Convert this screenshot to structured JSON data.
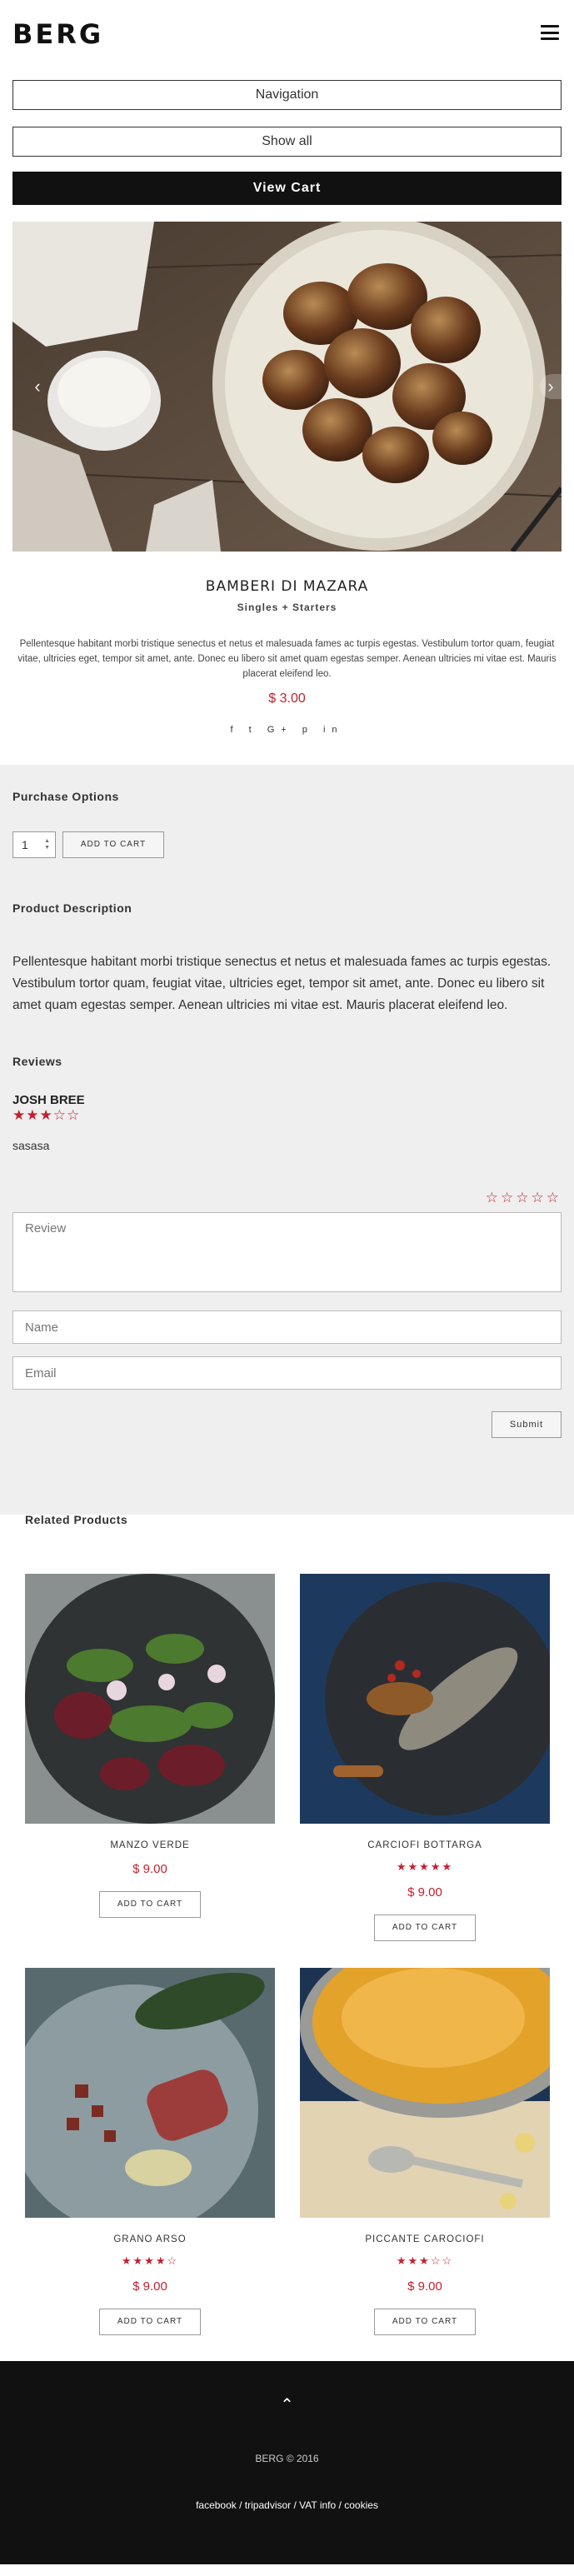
{
  "header": {
    "logo": "BERG",
    "menu_icon": "hamburger-icon"
  },
  "nav": {
    "navigation_label": "Navigation",
    "show_all_label": "Show all",
    "view_cart_label": "View Cart"
  },
  "slider": {
    "prev_icon": "chevron-left-icon",
    "next_icon": "chevron-right-icon",
    "prev_glyph": "‹",
    "next_glyph": "›"
  },
  "product": {
    "title": "BAMBERI DI MAZARA",
    "category": "Singles + Starters",
    "description": "Pellentesque habitant morbi tristique senectus et netus et malesuada fames ac turpis egestas. Vestibulum tortor quam, feugiat vitae, ultricies eget, tempor sit amet, ante. Donec eu libero sit amet quam egestas semper. Aenean ultricies mi vitae est. Mauris placerat eleifend leo.",
    "price": "$ 3.00",
    "social": [
      "f",
      "t",
      "G+",
      "p",
      "in"
    ]
  },
  "purchase": {
    "heading": "Purchase Options",
    "quantity": "1",
    "add_to_cart": "ADD TO CART"
  },
  "description_section": {
    "heading": "Product Description",
    "text": "Pellentesque habitant morbi tristique senectus et netus et malesuada fames ac turpis egestas. Vestibulum tortor quam, feugiat vitae, ultricies eget, tempor sit amet, ante. Donec eu libero sit amet quam egestas semper. Aenean ultricies mi vitae est. Mauris placerat eleifend leo."
  },
  "reviews": {
    "heading": "Reviews",
    "items": [
      {
        "author": "JOSH BREE",
        "rating": 3,
        "max": 5,
        "text": "sasasa"
      }
    ],
    "form": {
      "review_placeholder": "Review",
      "name_placeholder": "Name",
      "email_placeholder": "Email",
      "submit_label": "Submit",
      "rating": 0
    }
  },
  "related": {
    "heading": "Related Products",
    "items": [
      {
        "name": "MANZO VERDE",
        "price": "$ 9.00",
        "rating": null,
        "button": "ADD TO CART"
      },
      {
        "name": "CARCIOFI BOTTARGA",
        "price": "$ 9.00",
        "rating": 5,
        "button": "ADD TO CART"
      },
      {
        "name": "GRANO ARSO",
        "price": "$ 9.00",
        "rating": 4,
        "button": "ADD TO CART"
      },
      {
        "name": "PICCANTE CAROCIOFI",
        "price": "$ 9.00",
        "rating": 3,
        "button": "ADD TO CART"
      }
    ]
  },
  "footer": {
    "up_icon": "chevron-up-icon",
    "up_glyph": "⌃",
    "copyright": "BERG © 2016",
    "links": [
      "facebook",
      "tripadvisor",
      "VAT info",
      "cookies"
    ]
  },
  "colors": {
    "accent": "#c4202f",
    "dark": "#111111",
    "panel": "#efefef"
  }
}
